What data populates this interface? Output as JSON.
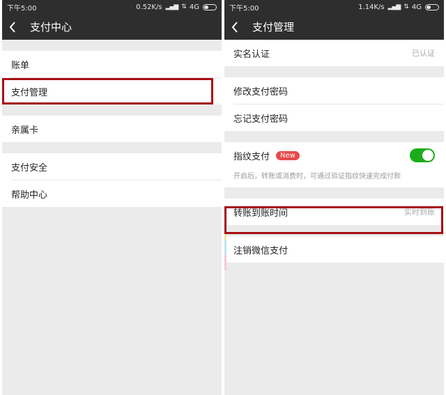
{
  "left": {
    "status": {
      "time": "下午5:00",
      "speed": "0.52K/s",
      "network": "4G"
    },
    "nav": {
      "title": "支付中心"
    },
    "items": [
      {
        "label": "账单"
      },
      {
        "label": "支付管理"
      },
      {
        "label": "亲属卡"
      },
      {
        "label": "支付安全"
      },
      {
        "label": "帮助中心"
      }
    ]
  },
  "right": {
    "status": {
      "time": "下午5:00",
      "speed": "1.14K/s",
      "network": "4G"
    },
    "nav": {
      "title": "支付管理"
    },
    "realname": {
      "label": "实名认证",
      "value": "已认证"
    },
    "change_password": {
      "label": "修改支付密码"
    },
    "forgot_password": {
      "label": "忘记支付密码"
    },
    "fingerprint": {
      "label": "指纹支付",
      "badge": "New",
      "enabled": true,
      "hint": "开启后，转账或消费时，可通过验证指纹快速完成付款"
    },
    "transfer_time": {
      "label": "转账到账时间",
      "value": "实时到账"
    },
    "cancel": {
      "label": "注销微信支付"
    }
  },
  "colors": {
    "header": "#2e2e2e",
    "highlight": "#a60d12",
    "toggle_on": "#1aad19",
    "badge": "#e84a4a"
  }
}
